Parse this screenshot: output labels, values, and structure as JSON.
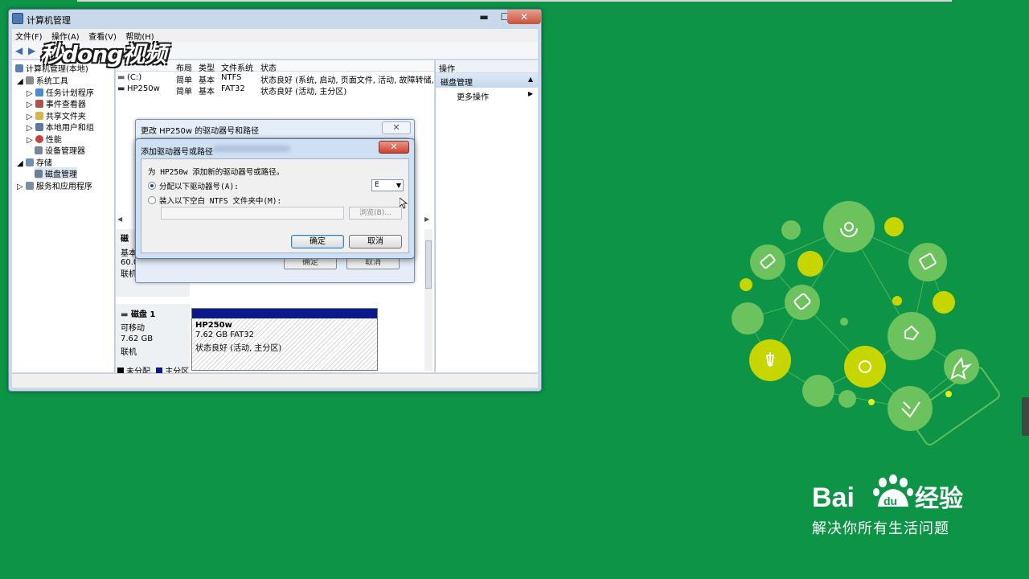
{
  "window": {
    "title": "计算机管理",
    "controls": {
      "minimize": "▬",
      "maximize": "☐",
      "close": "✕"
    }
  },
  "menu": [
    "文件(F)",
    "操作(A)",
    "查看(V)",
    "帮助(H)"
  ],
  "watermark": "秒dong视频",
  "tree": {
    "root": "计算机管理(本地)",
    "items": [
      "系统工具",
      "任务计划程序",
      "事件查看器",
      "共享文件夹",
      "本地用户和组",
      "性能",
      "设备管理器",
      "存储",
      "磁盘管理",
      "服务和应用程序"
    ]
  },
  "volumes": {
    "headers": [
      "布局",
      "类型",
      "文件系统",
      "状态"
    ],
    "rows": [
      {
        "name": "(C:)",
        "layout": "简单",
        "type": "基本",
        "fs": "NTFS",
        "status": "状态良好 (系统, 启动, 页面文件, 活动, 故障转储, :"
      },
      {
        "name": "HP250w",
        "layout": "简单",
        "type": "基本",
        "fs": "FAT32",
        "status": "状态良好 (活动, 主分区)"
      }
    ]
  },
  "disk0": {
    "label": "磁",
    "type": "基本",
    "size": "60.0",
    "status": "联机"
  },
  "disk1": {
    "label": "磁盘 1",
    "type": "可移动",
    "size": "7.62 GB",
    "status": "联机",
    "partition": {
      "name": "HP250w",
      "size": "7.62 GB FAT32",
      "status": "状态良好 (活动, 主分区)"
    }
  },
  "legend": {
    "unallocated": "未分配",
    "primary": "主分区"
  },
  "actions": {
    "header": "操作",
    "selected": "磁盘管理",
    "more": "更多操作"
  },
  "dialog_back": {
    "title": "更改 HP250w 的驱动器号和路径",
    "close": "✕",
    "ok": "确定",
    "cancel": "取消"
  },
  "dialog_front": {
    "title": "添加驱动器号或路径",
    "close": "✕",
    "prompt": "为 HP250w 添加新的驱动器号或路径。",
    "option_assign": "分配以下驱动器号(A):",
    "drive_letter": "E",
    "option_mount": "装入以下空白 NTFS 文件夹中(M):",
    "browse": "浏览(B)...",
    "ok": "确定",
    "cancel": "取消"
  },
  "brand": {
    "logo": "Bai du 经验",
    "tagline": "解决你所有生活问题"
  },
  "colors": {
    "background": "#0d9447",
    "primary_partition": "#0a1a8a",
    "deco_light": "#6cc35d",
    "deco_yellow": "#c8d600"
  }
}
